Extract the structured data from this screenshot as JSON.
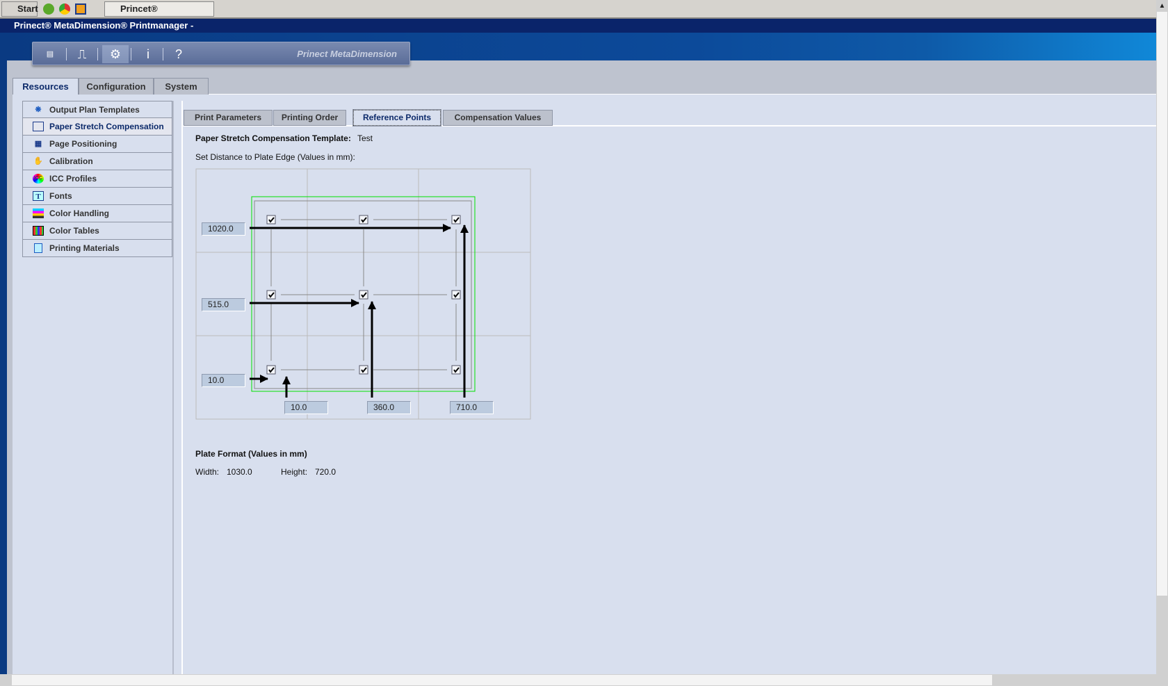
{
  "taskbar": {
    "start": "Start",
    "task": "Princet® MetaDimen..."
  },
  "window": {
    "title": "Prinect® MetaDimension® Printmanager -"
  },
  "toolbar": {
    "brand": "Prinect MetaDimension",
    "tools": [
      "abc-document-icon",
      "printer-icon",
      "settings-computer-icon",
      "info-icon",
      "help-icon"
    ],
    "info": "i",
    "help": "?"
  },
  "main_tabs": [
    "Resources",
    "Configuration",
    "System"
  ],
  "sidebar": {
    "items": [
      "Output Plan Templates",
      "Paper Stretch Compensation",
      "Page Positioning",
      "Calibration",
      "ICC Profiles",
      "Fonts",
      "Color Handling",
      "Color Tables",
      "Printing Materials"
    ],
    "selected": "Paper Stretch Compensation"
  },
  "sub_tabs": [
    "Print Parameters",
    "Printing Order",
    "Reference Points",
    "Compensation Values"
  ],
  "content": {
    "template_label": "Paper Stretch Compensation Template:",
    "template_value": "Test",
    "distance_label": "Set Distance to Plate Edge (Values in mm):",
    "rows": [
      "1020.0",
      "515.0",
      "10.0"
    ],
    "cols": [
      "10.0",
      "360.0",
      "710.0"
    ],
    "checkboxes_checked": [
      true,
      true,
      true,
      true,
      true,
      true,
      true,
      true,
      true
    ],
    "plate_format_label": "Plate Format (Values in mm)",
    "width_label": "Width:",
    "width_value": "1030.0",
    "height_label": "Height:",
    "height_value": "720.0"
  },
  "colors": {
    "accent": "#0c2a6a",
    "frame": "#00e000"
  }
}
